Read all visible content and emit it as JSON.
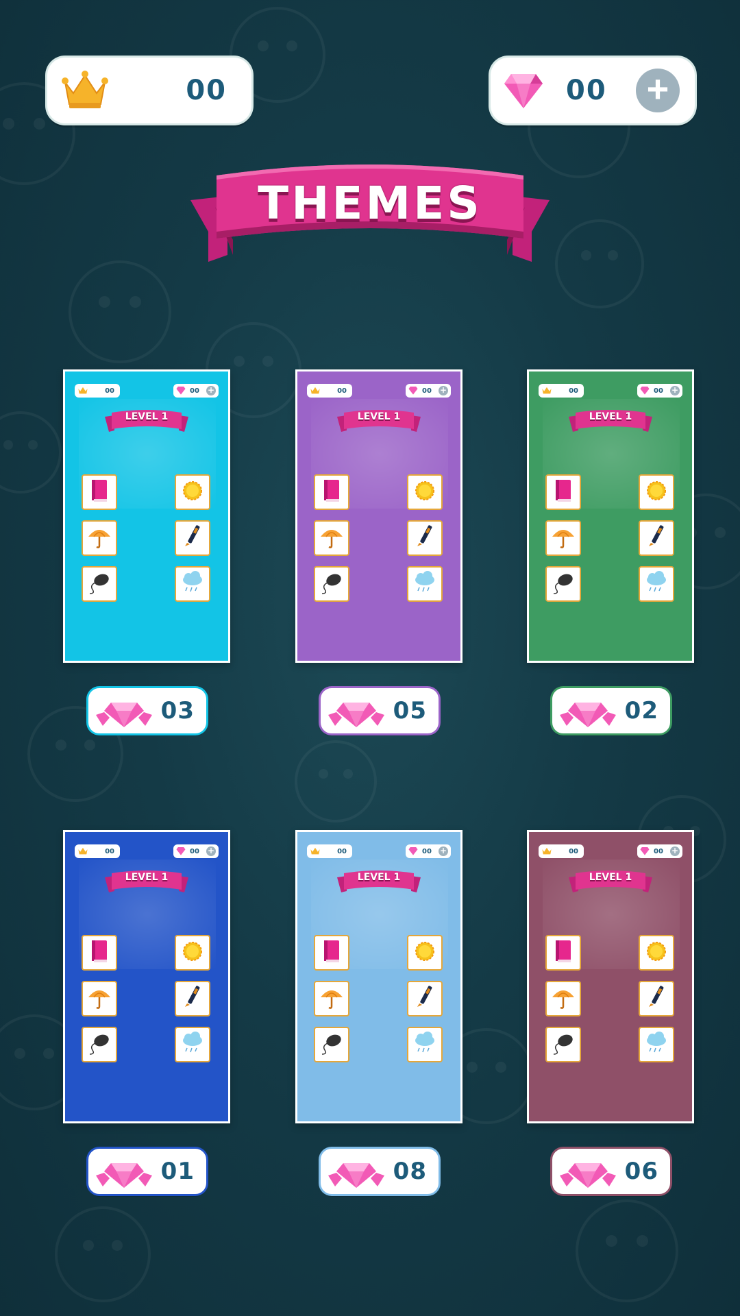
{
  "header": {
    "crowns": "00",
    "gems": "00",
    "title": "THEMES"
  },
  "colors": {
    "background": "#143a46",
    "accent_pink": "#e0348f",
    "value_text": "#1d5b7a",
    "tile_border": "#e5a73a"
  },
  "icons": {
    "crown": "crown-icon",
    "gem": "gem-icon",
    "plus": "plus-icon",
    "tiles": [
      "book-icon",
      "sun-icon",
      "umbrella-icon",
      "pen-icon",
      "mouse-icon",
      "rain-cloud-icon"
    ]
  },
  "themes": [
    {
      "color": "#13c4e6",
      "border": "#13c4e6",
      "level_label": "LEVEL 1",
      "mini_crowns": "00",
      "mini_gems": "00",
      "price": "03"
    },
    {
      "color": "#9b64c8",
      "border": "#9b64c8",
      "level_label": "LEVEL 1",
      "mini_crowns": "00",
      "mini_gems": "00",
      "price": "05"
    },
    {
      "color": "#3e9c62",
      "border": "#3e9c62",
      "level_label": "LEVEL 1",
      "mini_crowns": "00",
      "mini_gems": "00",
      "price": "02"
    },
    {
      "color": "#2354c8",
      "border": "#2354c8",
      "level_label": "LEVEL 1",
      "mini_crowns": "00",
      "mini_gems": "00",
      "price": "01"
    },
    {
      "color": "#80bce8",
      "border": "#80bce8",
      "level_label": "LEVEL 1",
      "mini_crowns": "00",
      "mini_gems": "00",
      "price": "08"
    },
    {
      "color": "#8f5068",
      "border": "#8f5068",
      "level_label": "LEVEL 1",
      "mini_crowns": "00",
      "mini_gems": "00",
      "price": "06"
    }
  ]
}
